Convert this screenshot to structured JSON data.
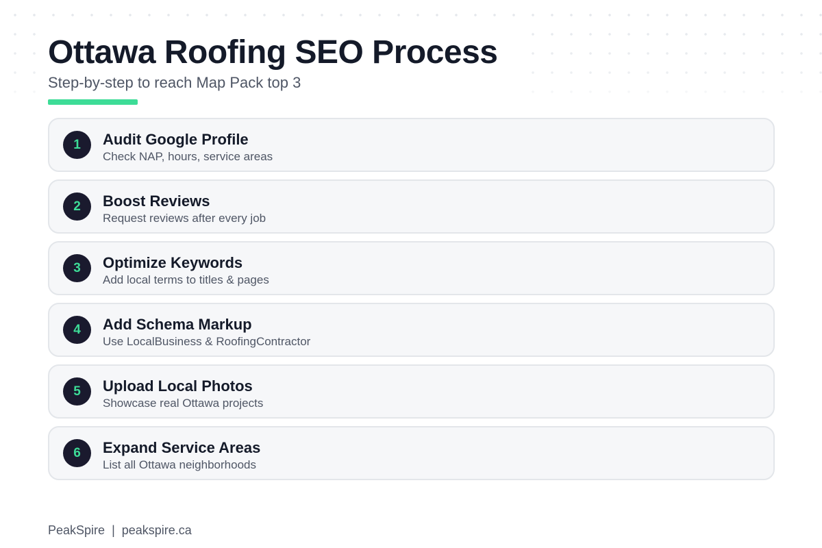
{
  "header": {
    "title": "Ottawa Roofing SEO Process",
    "subtitle": "Step-by-step to reach Map Pack top 3"
  },
  "steps": [
    {
      "number": "1",
      "title": "Audit Google Profile",
      "description": "Check NAP, hours, service areas"
    },
    {
      "number": "2",
      "title": "Boost Reviews",
      "description": "Request reviews after every job"
    },
    {
      "number": "3",
      "title": "Optimize Keywords",
      "description": "Add local terms to titles & pages"
    },
    {
      "number": "4",
      "title": "Add Schema Markup",
      "description": "Use LocalBusiness & RoofingContractor"
    },
    {
      "number": "5",
      "title": "Upload Local Photos",
      "description": "Showcase real Ottawa projects"
    },
    {
      "number": "6",
      "title": "Expand Service Areas",
      "description": "List all Ottawa neighborhoods"
    }
  ],
  "footer": {
    "brand": "PeakSpire",
    "separator": "|",
    "website": "peakspire.ca"
  },
  "colors": {
    "accent": "#3ddc97",
    "badge_background": "#1a1a2e",
    "badge_text": "#3ddc97"
  }
}
